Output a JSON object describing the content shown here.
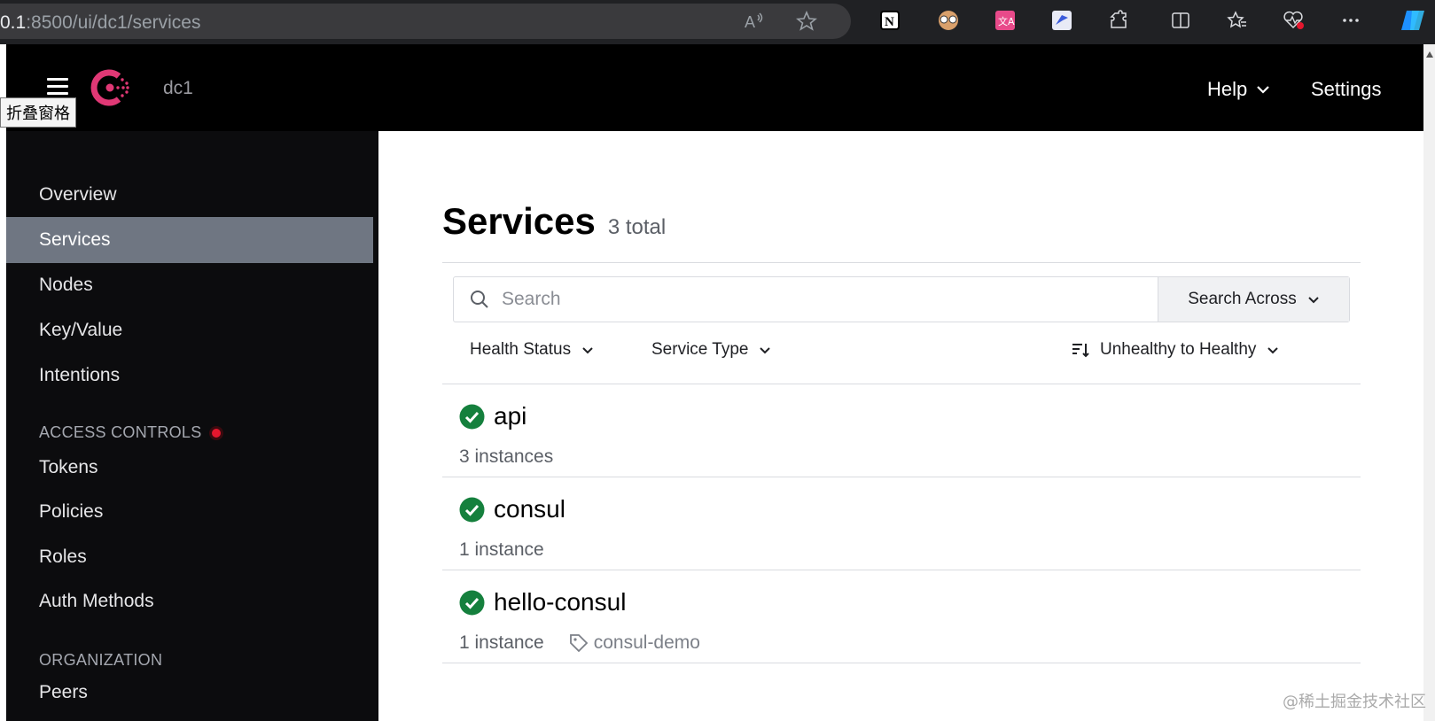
{
  "browser": {
    "url_host": "0.1",
    "url_rest": ":8500/ui/dc1/services"
  },
  "header": {
    "datacenter": "dc1",
    "help_label": "Help",
    "settings_label": "Settings",
    "tooltip": "折叠窗格"
  },
  "sidebar": {
    "items": [
      {
        "label": "Overview"
      },
      {
        "label": "Services"
      },
      {
        "label": "Nodes"
      },
      {
        "label": "Key/Value"
      },
      {
        "label": "Intentions"
      }
    ],
    "access_controls_title": "ACCESS CONTROLS",
    "access_items": [
      {
        "label": "Tokens"
      },
      {
        "label": "Policies"
      },
      {
        "label": "Roles"
      },
      {
        "label": "Auth Methods"
      }
    ],
    "organization_title": "ORGANIZATION",
    "organization_items": [
      {
        "label": "Peers"
      }
    ]
  },
  "main": {
    "title": "Services",
    "total": "3 total",
    "search_placeholder": "Search",
    "search_across": "Search Across",
    "filters": {
      "health": "Health Status",
      "type": "Service Type",
      "sort": "Unhealthy to Healthy"
    },
    "services": [
      {
        "name": "api",
        "instances": "3 instances",
        "tag": ""
      },
      {
        "name": "consul",
        "instances": "1 instance",
        "tag": ""
      },
      {
        "name": "hello-consul",
        "instances": "1 instance",
        "tag": "consul-demo"
      }
    ]
  },
  "colors": {
    "brand": "#e03875",
    "healthy": "#15803d",
    "active_nav": "#6f7682"
  },
  "watermark": "@稀土掘金技术社区"
}
